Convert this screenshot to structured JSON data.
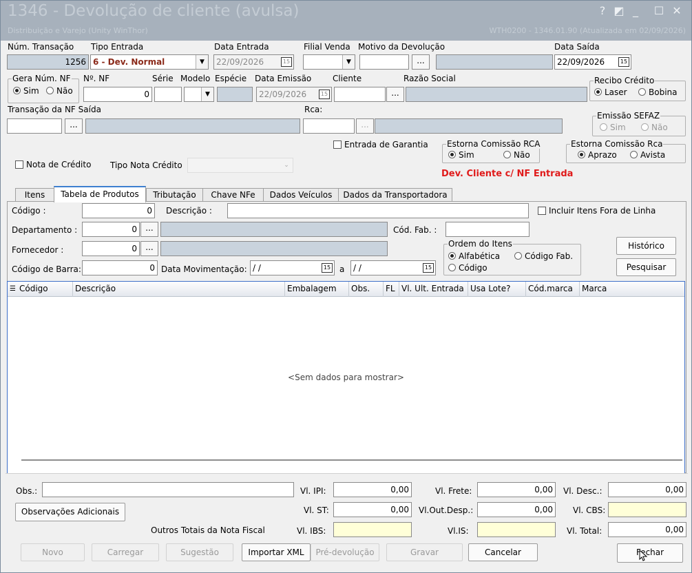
{
  "window": {
    "title": "1346 - Devolução de cliente (avulsa)",
    "subtitle": "Distribuição e Varejo (Unity WinThor)",
    "subright": "WTH0200 - 1346.01.90 (Atualizada em 02/09/2026)",
    "help": "?",
    "pin": "◩",
    "minimize": "_",
    "maximize": "☐",
    "close": "✕"
  },
  "header": {
    "num_transacao_label": "Núm. Transação",
    "num_transacao_value": "1256",
    "tipo_entrada_label": "Tipo Entrada",
    "tipo_entrada_value": "6 - Dev. Normal",
    "data_entrada_label": "Data Entrada",
    "data_entrada_value": "22/09/2026",
    "filial_label": "Filial Venda",
    "filial_value": "",
    "motivo_label": "Motivo da Devolução",
    "motivo_value": "",
    "data_saida_label": "Data Saída",
    "data_saida_value": "22/09/2026",
    "gera_label": "Gera Núm. NF",
    "sim": "Sim",
    "nao": "Não",
    "nnf_label": "Nº. NF",
    "nnf_value": "0",
    "serie_label": "Série",
    "modelo_label": "Modelo",
    "especie_label": "Espécie",
    "data_emissao_label": "Data Emissão",
    "data_emissao_value": "22/09/2026",
    "cliente_label": "Cliente",
    "razao_label": "Razão Social",
    "recibo_label": "Recibo Crédito",
    "laser": "Laser",
    "bobina": "Bobina",
    "transacao_nf_label": "Transação da NF Saída",
    "rca_label": "Rca:",
    "emissao_sefaz_label": "Emissão SEFAZ",
    "entrada_garantia": "Entrada de Garantia",
    "estorna_rca_label": "Estorna Comissão RCA",
    "estorna_rca2_label": "Estorna Comissão Rca",
    "aprazo": "Aprazo",
    "avista": "Avista",
    "nota_credito": "Nota de Crédito",
    "tipo_nota_credito": "Tipo Nota Crédito",
    "dev_msg": "Dev. Cliente c/ NF Entrada",
    "ellipsis": "..."
  },
  "tabs": [
    {
      "label": "Itens"
    },
    {
      "label": "Tabela de Produtos"
    },
    {
      "label": "Tributação"
    },
    {
      "label": "Chave NFe"
    },
    {
      "label": "Dados Veículos"
    },
    {
      "label": "Dados da Transportadora"
    }
  ],
  "filters": {
    "codigo_label": "Código :",
    "codigo_value": "0",
    "descricao_label": "Descrição :",
    "descricao_value": "",
    "incluir_label": "Incluir Itens Fora de Linha",
    "departamento_label": "Departamento :",
    "departamento_value": "0",
    "cod_fab_label": "Cód. Fab. :",
    "fornecedor_label": "Fornecedor :",
    "fornecedor_value": "0",
    "ordem_label": "Ordem do Itens",
    "alfabetica": "Alfabética",
    "codigo_fab": "Código Fab.",
    "codigo": "Código",
    "cod_barra_label": "Código de Barra:",
    "cod_barra_value": "0",
    "data_mov_label": "Data Movimentação:",
    "data_mov_from": "/ /",
    "data_a": "a",
    "data_mov_to": "/ /",
    "historico": "Histórico",
    "pesquisar": "Pesquisar"
  },
  "grid": {
    "columns": [
      "Código",
      "Descrição",
      "Embalagem",
      "Obs.",
      "FL",
      "Vl. Ult. Entrada",
      "Usa Lote?",
      "Cód.marca",
      "Marca"
    ],
    "empty_text": "<Sem dados para mostrar>"
  },
  "footer": {
    "obs_label": "Obs.:",
    "obs_adicionais": "Observações Adicionais",
    "outros_totais": "Outros Totais da Nota Fiscal",
    "vl_ipi_label": "Vl. IPI:",
    "vl_ipi": "0,00",
    "vl_st_label": "Vl. ST:",
    "vl_st": "0,00",
    "vl_ibs_label": "Vl. IBS:",
    "vl_ibs": "",
    "vl_frete_label": "Vl. Frete:",
    "vl_frete": "0,00",
    "vl_outdesp_label": "Vl.Out.Desp.:",
    "vl_outdesp": "0,00",
    "vl_is_label": "Vl.IS:",
    "vl_is": "",
    "vl_desc_label": "Vl. Desc.:",
    "vl_desc": "0,00",
    "vl_cbs_label": "Vl. CBS:",
    "vl_cbs": "",
    "vl_total_label": "Vl. Total:",
    "vl_total": "0,00"
  },
  "buttons": {
    "novo": "Novo",
    "carregar": "Carregar",
    "sugestao": "Sugestão",
    "importar_xml": "Importar XML",
    "pre_devolucao": "Pré-devolução",
    "gravar": "Gravar",
    "cancelar": "Cancelar",
    "fechar": "Fechar"
  }
}
